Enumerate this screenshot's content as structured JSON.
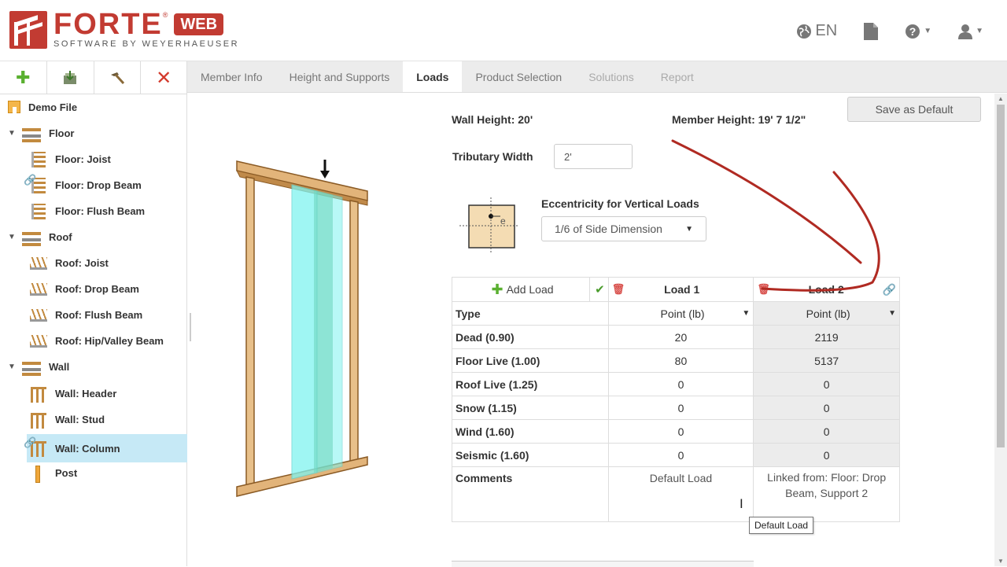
{
  "header": {
    "logo_main": "FORTE",
    "logo_registered": "®",
    "logo_badge": "WEB",
    "logo_tagline": "SOFTWARE BY WEYERHAEUSER",
    "language": "EN",
    "brand_color": "#c23b32"
  },
  "toolbar": {
    "buttons": [
      {
        "icon": "add-icon",
        "glyph": "+",
        "color": "#5ab030"
      },
      {
        "icon": "import-icon",
        "glyph": "⇩",
        "color": "#5a8a3a"
      },
      {
        "icon": "tools-icon",
        "glyph": "⚒",
        "color": "#6b5a3a"
      },
      {
        "icon": "delete-icon",
        "glyph": "✕",
        "color": "#d33a2c"
      }
    ]
  },
  "tabs": [
    {
      "label": "Member Info",
      "state": "normal"
    },
    {
      "label": "Height and Supports",
      "state": "normal"
    },
    {
      "label": "Loads",
      "state": "active"
    },
    {
      "label": "Product Selection",
      "state": "normal"
    },
    {
      "label": "Solutions",
      "state": "disabled"
    },
    {
      "label": "Report",
      "state": "disabled"
    }
  ],
  "tree": {
    "root": "Demo File",
    "items": [
      {
        "label": "Floor",
        "level": 1,
        "expanded": true
      },
      {
        "label": "Floor: Joist",
        "level": 2
      },
      {
        "label": "Floor: Drop Beam",
        "level": 2,
        "linked": true
      },
      {
        "label": "Floor: Flush Beam",
        "level": 2
      },
      {
        "label": "Roof",
        "level": 1,
        "expanded": true
      },
      {
        "label": "Roof: Joist",
        "level": 2
      },
      {
        "label": "Roof: Drop Beam",
        "level": 2
      },
      {
        "label": "Roof: Flush Beam",
        "level": 2
      },
      {
        "label": "Roof: Hip/Valley Beam",
        "level": 2
      },
      {
        "label": "Wall",
        "level": 1,
        "expanded": true
      },
      {
        "label": "Wall: Header",
        "level": 2
      },
      {
        "label": "Wall: Stud",
        "level": 2
      },
      {
        "label": "Wall: Column",
        "level": 2,
        "selected": true,
        "linked": true
      },
      {
        "label": "Post",
        "level": 2
      }
    ]
  },
  "main": {
    "save_default": "Save as Default",
    "wall_height": "Wall Height: 20'",
    "member_height": "Member Height: 19' 7 1/2\"",
    "tributary_label": "Tributary Width",
    "tributary_value": "2'",
    "eccentricity_label": "Eccentricity for Vertical Loads",
    "eccentricity_value": "1/6 of Side Dimension",
    "eccentricity_symbol": "e"
  },
  "loads_table": {
    "add_load": "Add Load",
    "columns": [
      "Load 1",
      "Load 2"
    ],
    "type_label": "Type",
    "type_values": [
      "Point (lb)",
      "Point (lb)"
    ],
    "rows": [
      {
        "label": "Dead (0.90)",
        "values": [
          "20",
          "2119"
        ]
      },
      {
        "label": "Floor Live (1.00)",
        "values": [
          "80",
          "5137"
        ]
      },
      {
        "label": "Roof Live (1.25)",
        "values": [
          "0",
          "0"
        ]
      },
      {
        "label": "Snow (1.15)",
        "values": [
          "0",
          "0"
        ]
      },
      {
        "label": "Wind (1.60)",
        "values": [
          "0",
          "0"
        ]
      },
      {
        "label": "Seismic (1.60)",
        "values": [
          "0",
          "0"
        ]
      }
    ],
    "comments_label": "Comments",
    "comments": [
      "Default Load",
      "Linked from: Floor: Drop Beam, Support 2"
    ]
  },
  "tooltip": "Default Load"
}
